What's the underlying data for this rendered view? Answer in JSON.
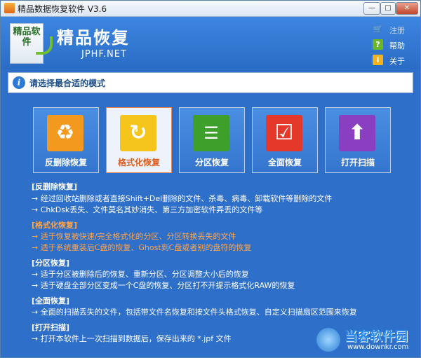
{
  "window": {
    "title": "精品数据恢复软件 V3.6",
    "buttons": {
      "minimize": "—",
      "maximize": "□",
      "close": "✕"
    }
  },
  "header": {
    "logo_text": "精品软件",
    "app_name": "精品恢复",
    "site": "JPHF.NET",
    "links": [
      {
        "label": "注册",
        "icon": "cart-icon"
      },
      {
        "label": "帮助",
        "icon": "help-icon"
      },
      {
        "label": "关于",
        "icon": "info-icon"
      }
    ]
  },
  "info": {
    "text": "请选择最合适的模式",
    "icon_glyph": "i"
  },
  "modes": [
    {
      "label": "反删除恢复",
      "icon": "recycle-bin-icon",
      "color": "#f39a1e"
    },
    {
      "label": "格式化恢复",
      "icon": "refresh-icon",
      "color": "#f6c51b"
    },
    {
      "label": "分区恢复",
      "icon": "checklist-icon",
      "color": "#3f9f2b"
    },
    {
      "label": "全面恢复",
      "icon": "checkbox-icon",
      "color": "#e4382a"
    },
    {
      "label": "打开扫描",
      "icon": "up-arrow-icon",
      "color": "#8a3fc0"
    }
  ],
  "descriptions": [
    {
      "heading": "[反删除恢复]",
      "lines": [
        "→ 经过回收站删除或者直接Shift+Del删除的文件、杀毒、病毒、卸载软件等删除的文件",
        "→ ChkDsk丢失、文件莫名其妙消失、第三方加密软件弄丢的文件等"
      ]
    },
    {
      "heading": "[格式化恢复]",
      "lines": [
        "→ 适于恢复被快速/完全格式化的分区、分区转换丢失的文件",
        "→ 适于系统重装后C盘的恢复、Ghost到C盘或者别的盘符的恢复"
      ]
    },
    {
      "heading": "[分区恢复]",
      "lines": [
        "→ 适于分区被删除后的恢复、重新分区、分区调整大小后的恢复",
        "→ 适于硬盘全部分区变成一个C盘的恢复、分区打不开提示格式化RAW的恢复"
      ]
    },
    {
      "heading": "[全面恢复]",
      "lines": [
        "→ 全面的扫描丢失的文件，包括带文件名恢复和按文件头格式恢复、自定义扫描扇区范围来恢复"
      ]
    },
    {
      "heading": "[打开扫描]",
      "lines": [
        "→ 打开本软件上一次扫描到数据后，保存出来的 *.jpf 文件"
      ]
    }
  ],
  "watermark": {
    "name": "当客软件园",
    "url": "www.downkr.com"
  }
}
